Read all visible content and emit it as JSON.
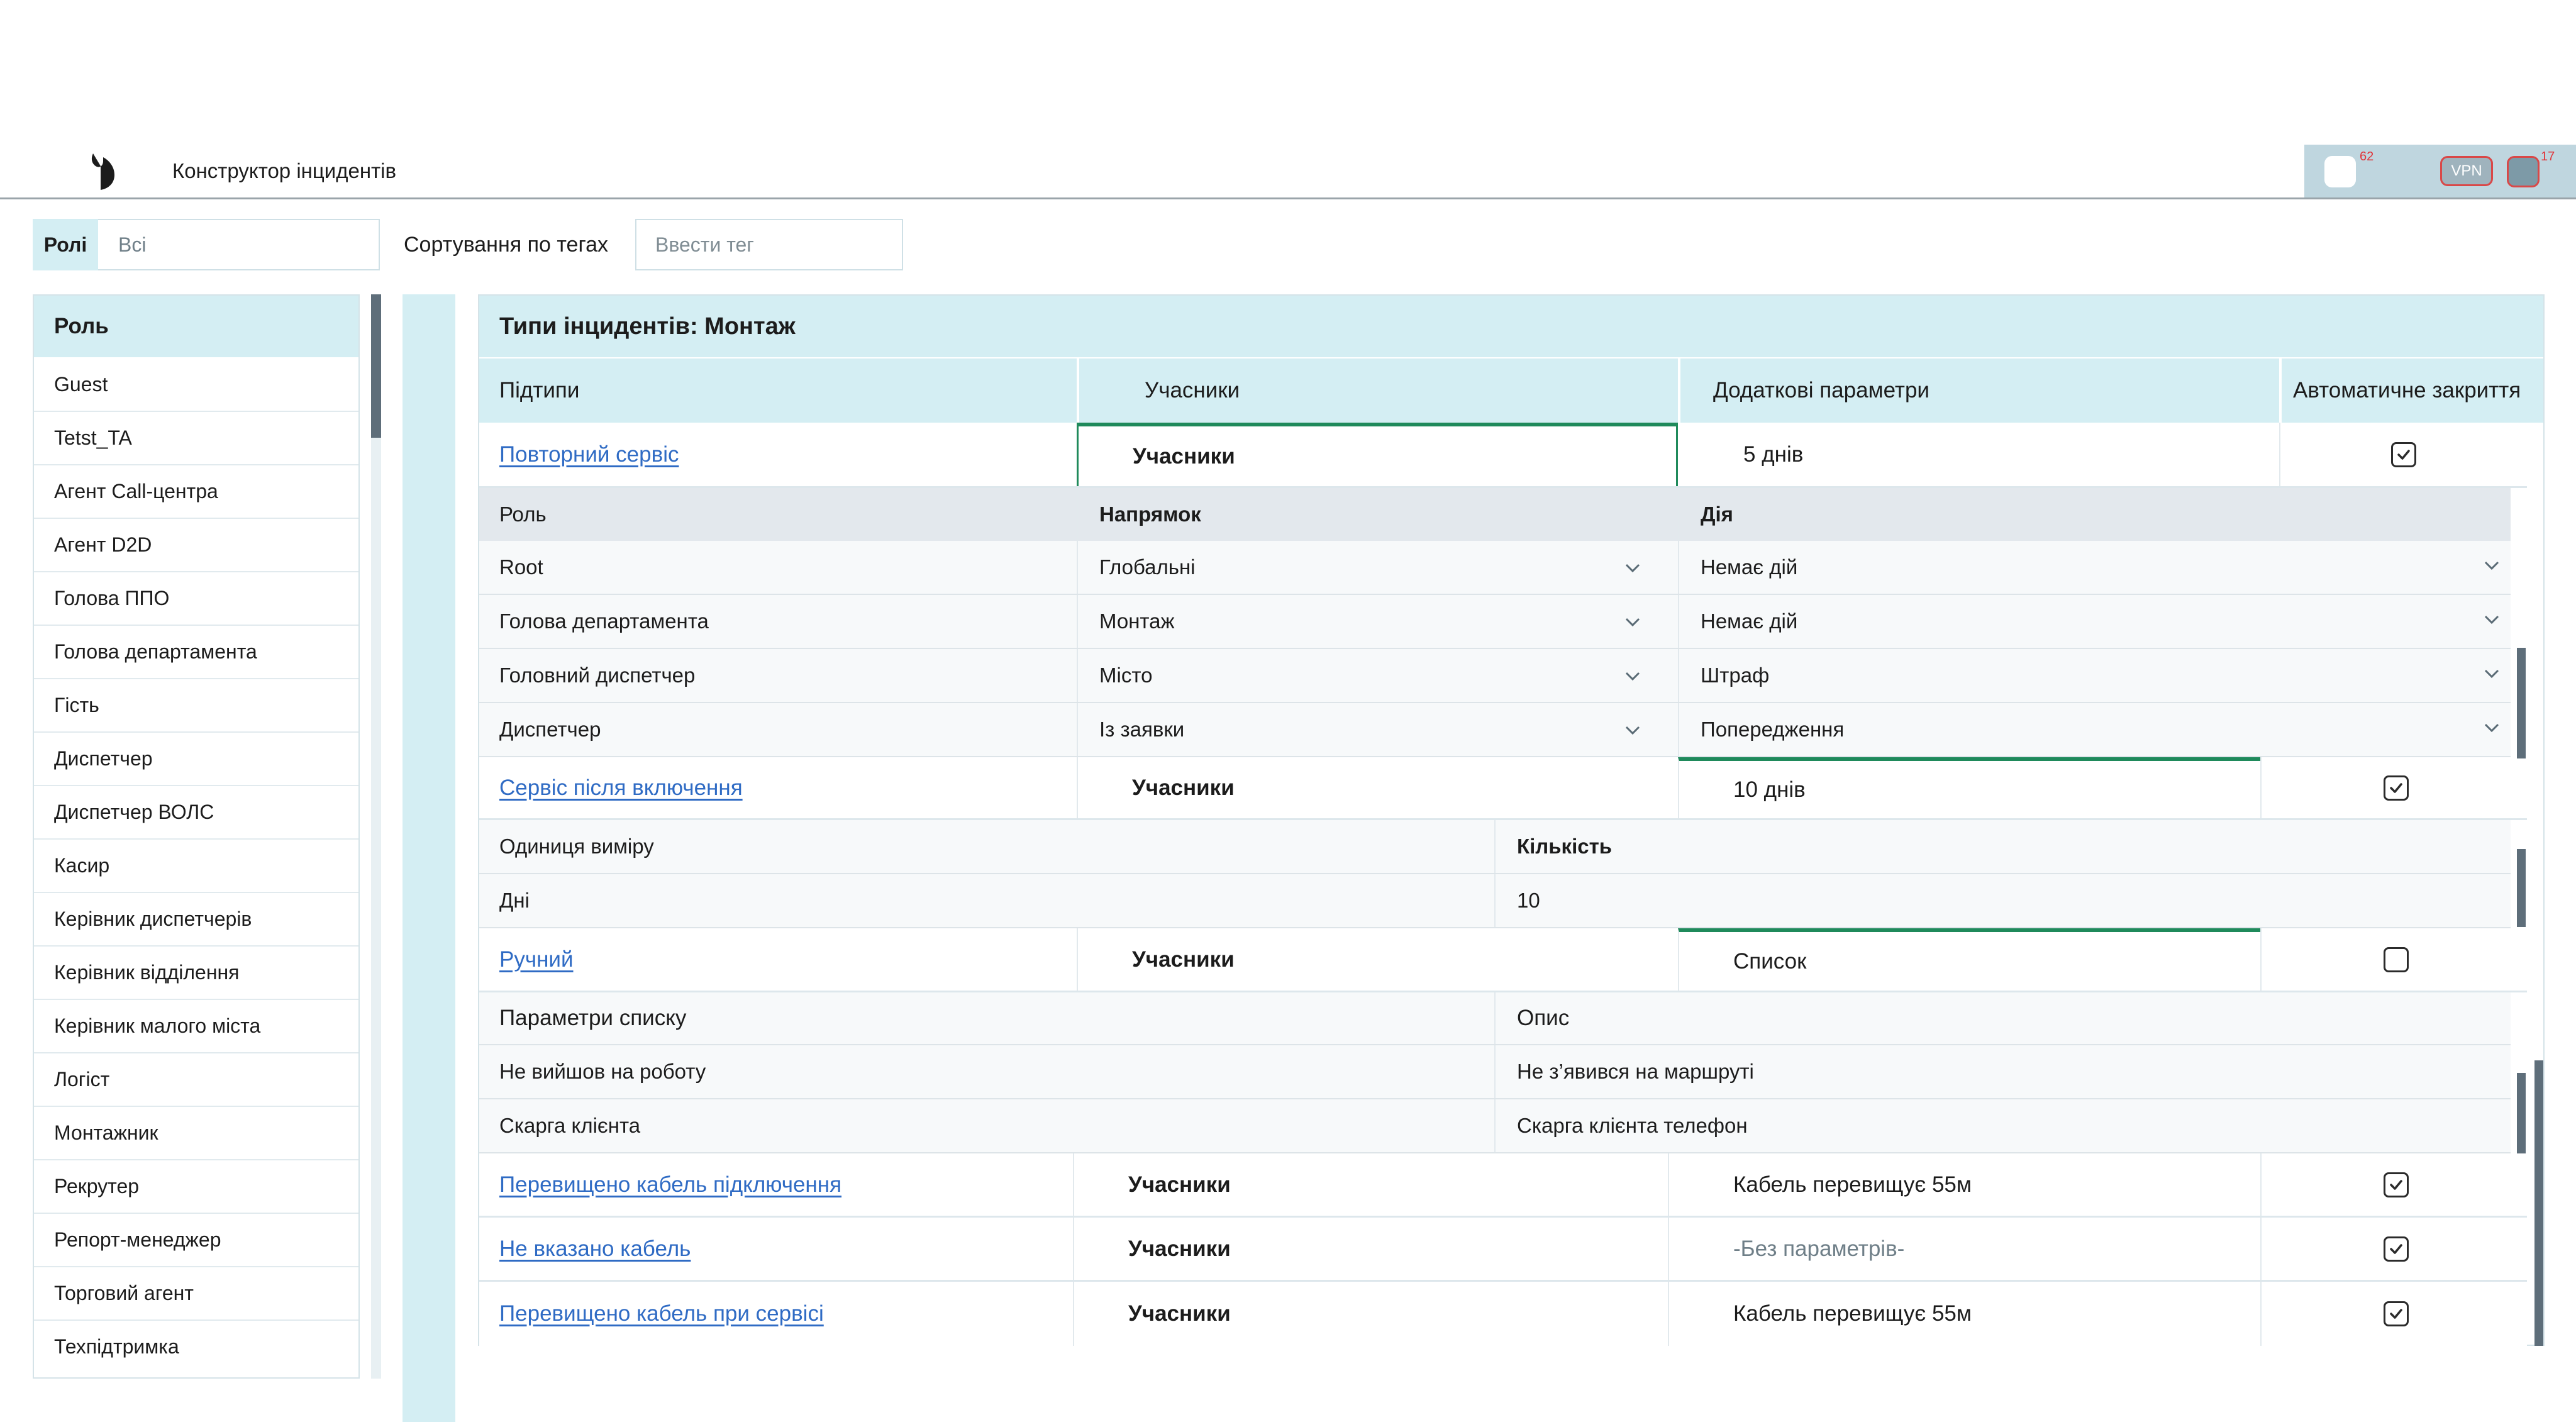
{
  "header": {
    "app_title": "Конструктор інцидентів",
    "notification_count_1": "62",
    "vpn_label": "VPN",
    "notification_count_2": "17"
  },
  "filters": {
    "roles_label": "Ролі",
    "roles_value": "Всі",
    "tag_sort_label": "Сортування по тегах",
    "tag_placeholder": "Ввести тег"
  },
  "sidebar": {
    "header": "Роль",
    "items": [
      "Guest",
      "Tetst_TA",
      "Агент Call-центра",
      "Агент D2D",
      "Голова ППО",
      "Голова департамента",
      "Гість",
      "Диспетчер",
      "Диспетчер ВОЛС",
      "Касир",
      "Керівник диспетчерів",
      "Керівник відділення",
      "Керівник малого міста",
      "Логіст",
      "Монтажник",
      "Рекрутер",
      "Репорт-менеджер",
      "Торговий агент",
      "Техпідтримка"
    ]
  },
  "main": {
    "title": "Типи інцидентів: Монтаж",
    "columns": [
      "Підтипи",
      "Учасники",
      "Додаткові параметри",
      "Автоматичне закриття"
    ],
    "rows": [
      {
        "name": "Повторний сервіс",
        "participants": "Учасники",
        "params": "5 днів",
        "auto_close": true
      },
      {
        "name": "Сервіс після включення",
        "participants": "Учасники",
        "params": "10 днів",
        "auto_close": true
      },
      {
        "name": "Ручний",
        "participants": "Учасники",
        "params": "Список",
        "auto_close": false
      },
      {
        "name": "Перевищено кабель підключення",
        "participants": "Учасники",
        "params": "Кабель перевищує 55м",
        "auto_close": true
      },
      {
        "name": "Не вказано кабель",
        "participants": "Учасники",
        "params": "-Без параметрів-",
        "auto_close": true
      },
      {
        "name": "Перевищено кабель при сервісі",
        "participants": "Учасники",
        "params": "Кабель перевищує 55м",
        "auto_close": true
      }
    ],
    "participants_table": {
      "columns": [
        "Роль",
        "Напрямок",
        "Дія"
      ],
      "rows": [
        {
          "role": "Root",
          "direction": "Глобальні",
          "action": "Немає дій"
        },
        {
          "role": "Голова департамента",
          "direction": "Монтаж",
          "action": "Немає дій"
        },
        {
          "role": "Головний диспетчер",
          "direction": "Місто",
          "action": "Штраф"
        },
        {
          "role": "Диспетчер",
          "direction": "Із заявки",
          "action": "Попередження"
        }
      ]
    },
    "params_table": {
      "columns": [
        "Одиниця виміру",
        "Кількість"
      ],
      "rows": [
        {
          "unit": "Дні",
          "quantity": "10"
        }
      ]
    },
    "list_table": {
      "columns": [
        "Параметри списку",
        "Опис"
      ],
      "rows": [
        {
          "param": "Не вийшов на роботу",
          "description": "Не з’явився на маршруті"
        },
        {
          "param": "Скарга клієнта",
          "description": "Скарга клієнта телефон"
        }
      ]
    }
  },
  "colors": {
    "accent_light": "#d4eef3",
    "link": "#2f6bc4",
    "active_underline": "#1f8a5b",
    "badge": "#e0353a"
  },
  "icons": {
    "logo": "brand-logo-icon",
    "check": "checkmark-icon",
    "dropdown": "chevron-down-icon"
  }
}
